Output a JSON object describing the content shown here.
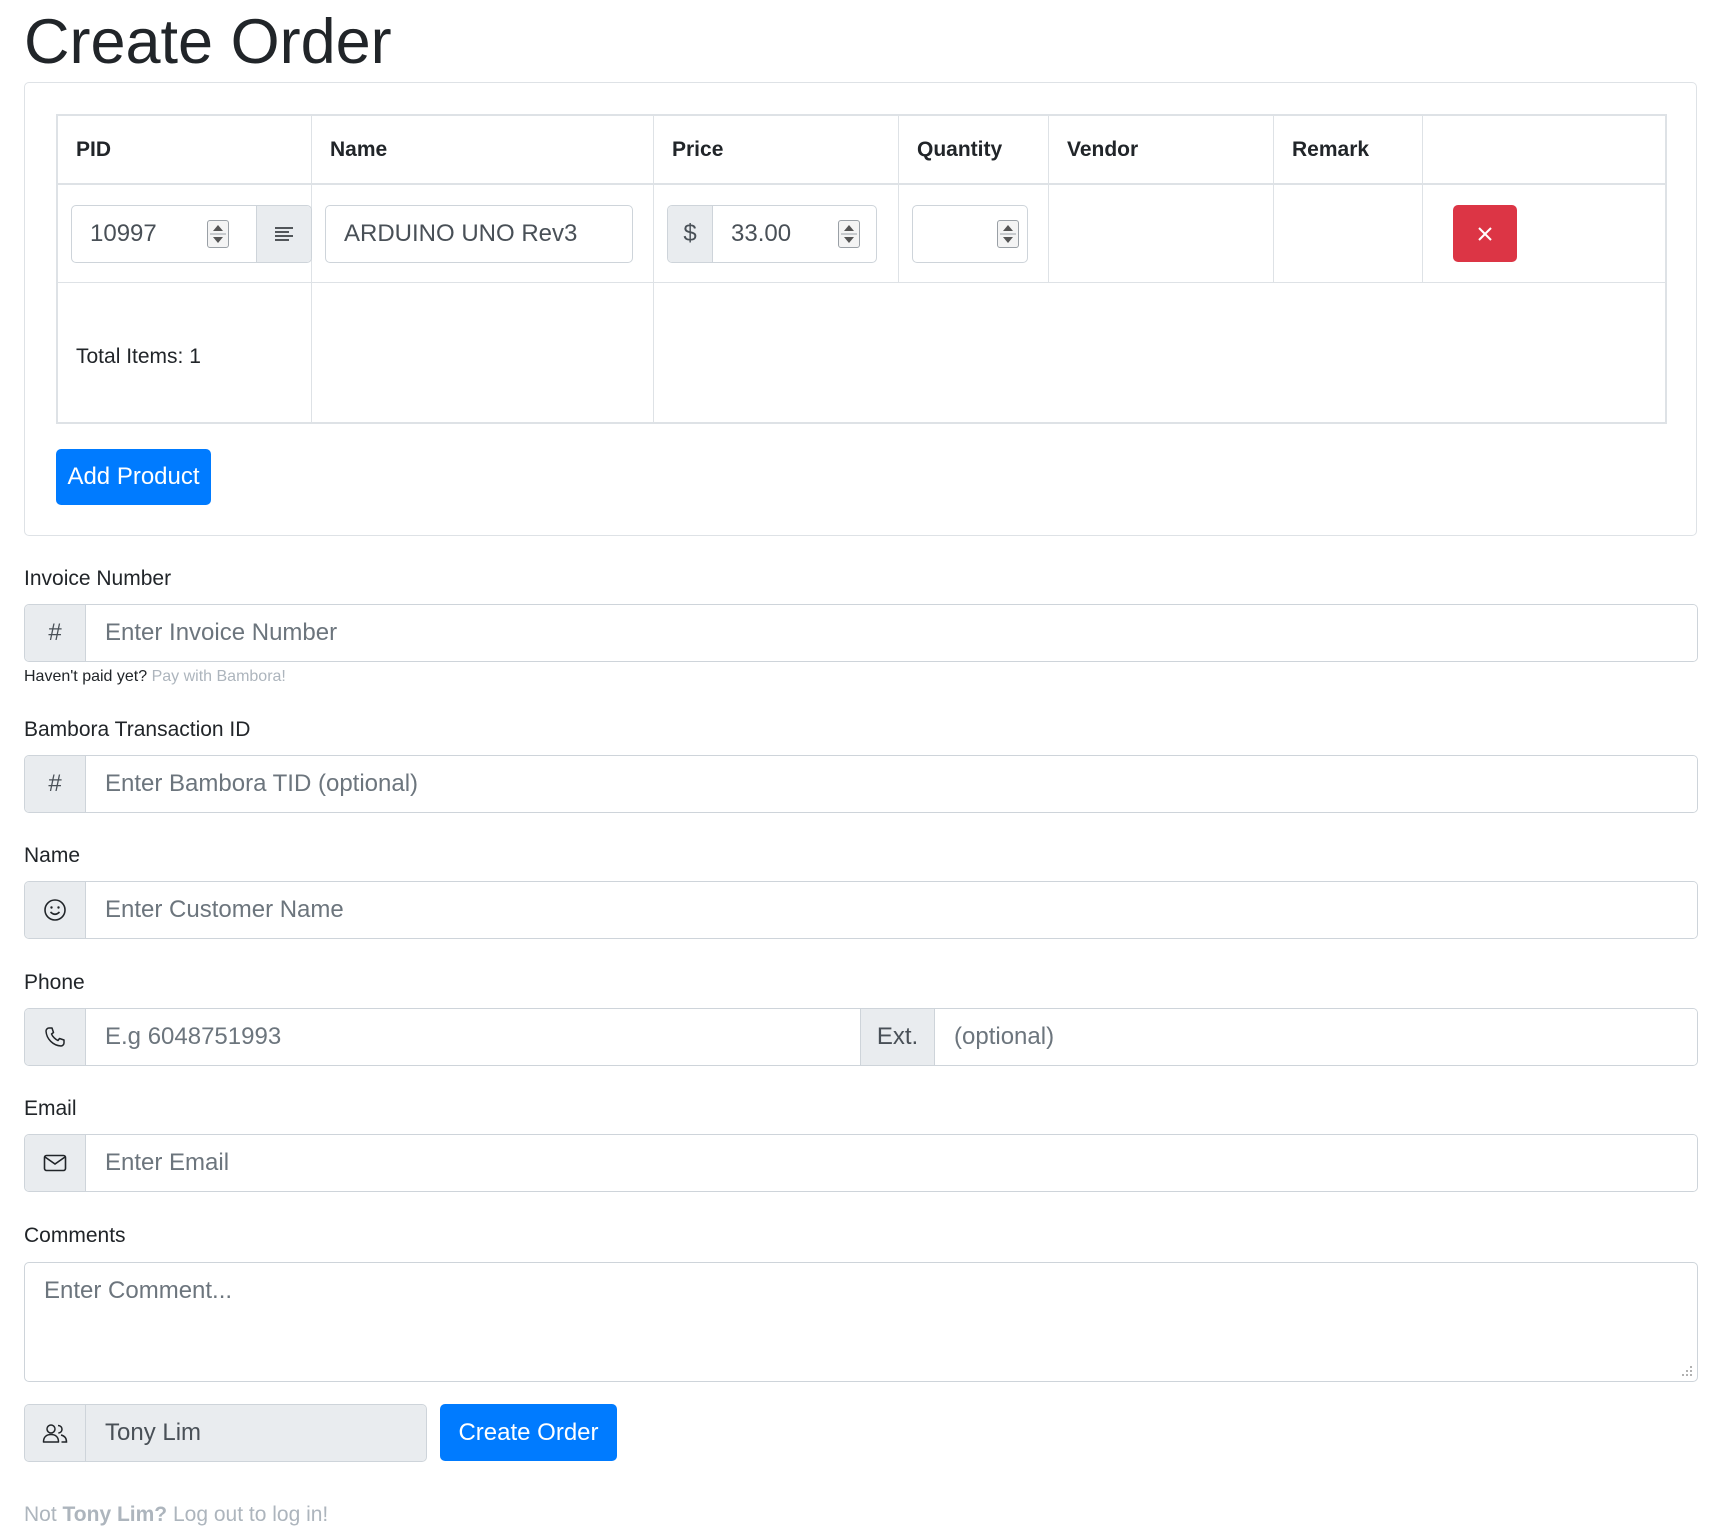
{
  "page": {
    "title": "Create Order"
  },
  "products": {
    "headers": {
      "pid": "PID",
      "name": "Name",
      "price": "Price",
      "quantity": "Quantity",
      "vendor": "Vendor",
      "remark": "Remark"
    },
    "rows": [
      {
        "pid": "10997",
        "name": "ARDUINO UNO Rev3",
        "currency": "$",
        "price": "33.00",
        "quantity": "",
        "vendor": "",
        "remark": ""
      }
    ],
    "total_items": "Total Items: 1",
    "add_product_label": "Add Product"
  },
  "invoice": {
    "label": "Invoice Number",
    "addon": "#",
    "placeholder": "Enter Invoice Number",
    "help_prefix": "Haven't paid yet?",
    "help_link": "Pay with Bambora!"
  },
  "bambora": {
    "label": "Bambora Transaction ID",
    "addon": "#",
    "placeholder": "Enter Bambora TID (optional)"
  },
  "customer_name": {
    "label": "Name",
    "placeholder": "Enter Customer Name",
    "icon": "smiley-icon"
  },
  "phone": {
    "label": "Phone",
    "placeholder": "E.g 6048751993",
    "ext_label": "Ext.",
    "ext_placeholder": "(optional)",
    "icon": "phone-icon"
  },
  "email": {
    "label": "Email",
    "placeholder": "Enter Email",
    "icon": "envelope-icon"
  },
  "comments": {
    "label": "Comments",
    "placeholder": "Enter Comment..."
  },
  "user": {
    "name": "Tony Lim",
    "icon": "people-icon"
  },
  "create_order_label": "Create Order",
  "footer": {
    "prefix": "Not",
    "user": "Tony Lim?",
    "suffix": "Log out to log in!"
  },
  "colors": {
    "primary": "#007bff",
    "danger": "#dc3545",
    "addon_bg": "#e9ecef",
    "border": "#ced4da"
  }
}
